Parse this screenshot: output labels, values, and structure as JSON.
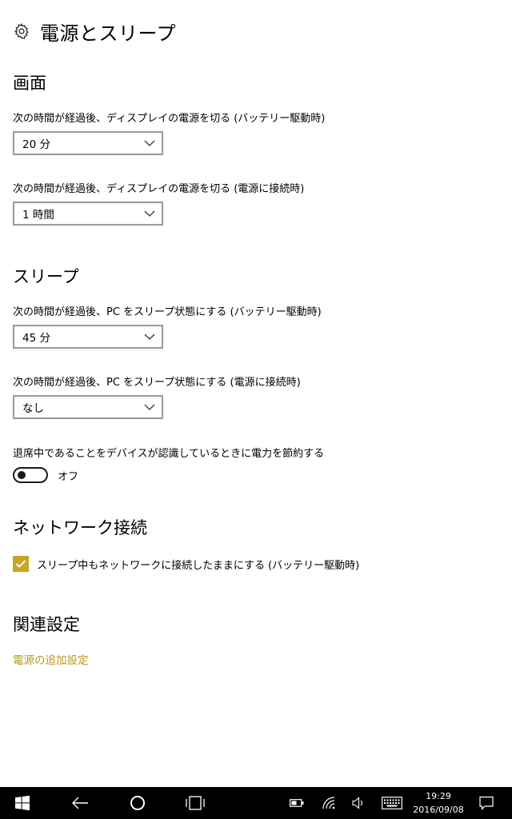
{
  "header": {
    "title": "電源とスリープ",
    "icon": "gear-icon"
  },
  "screen": {
    "section_title": "画面",
    "battery_label": "次の時間が経過後、ディスプレイの電源を切る (バッテリー駆動時)",
    "battery_value": "20 分",
    "plugged_label": "次の時間が経過後、ディスプレイの電源を切る (電源に接続時)",
    "plugged_value": "1 時間"
  },
  "sleep": {
    "section_title": "スリープ",
    "battery_label": "次の時間が経過後、PC をスリープ状態にする (バッテリー駆動時)",
    "battery_value": "45 分",
    "plugged_label": "次の時間が経過後、PC をスリープ状態にする (電源に接続時)",
    "plugged_value": "なし",
    "away_label": "退席中であることをデバイスが認識しているときに電力を節約する",
    "away_toggle_label": "オフ"
  },
  "network": {
    "section_title": "ネットワーク接続",
    "checkbox_label": "スリープ中もネットワークに接続したままにする (バッテリー駆動時)"
  },
  "related": {
    "section_title": "関連設定",
    "link_label": "電源の追加設定"
  },
  "taskbar": {
    "time": "19:29",
    "date": "2016/09/08"
  },
  "colors": {
    "accent": "#c8a524",
    "link": "#b8961e",
    "taskbar": "#000000"
  }
}
